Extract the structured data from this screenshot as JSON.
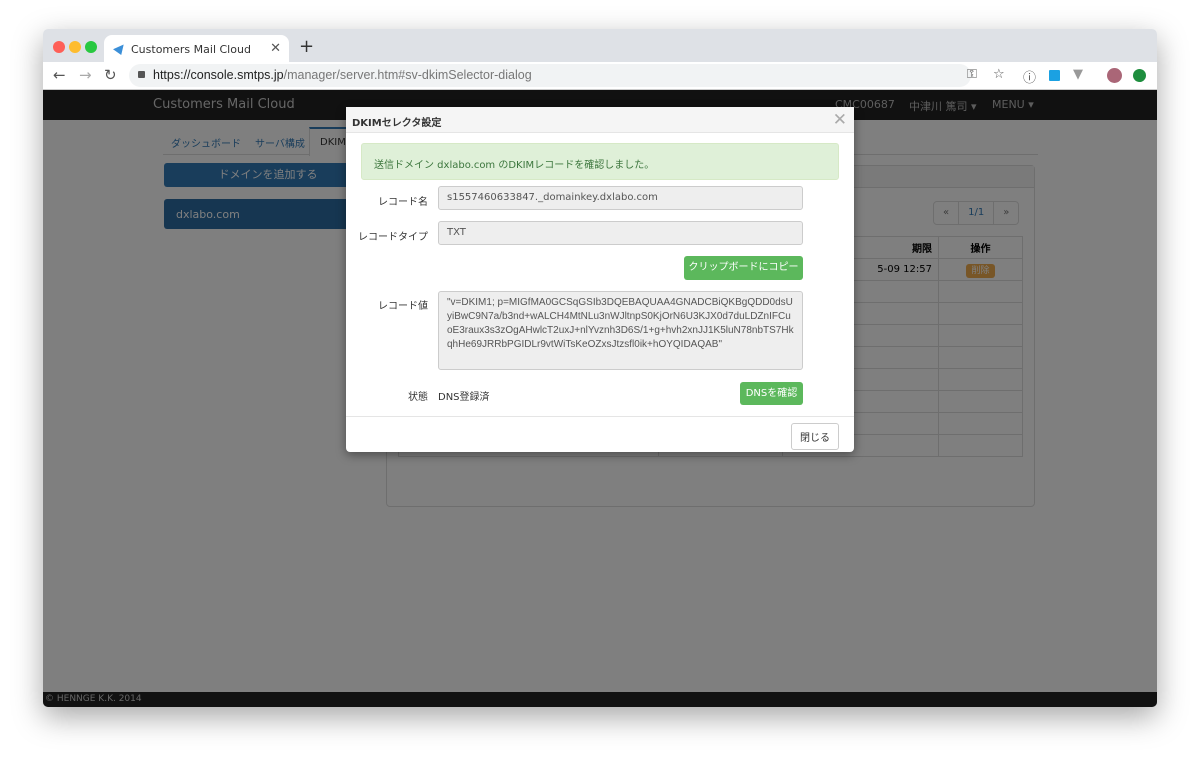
{
  "browser": {
    "tab_title": "Customers Mail Cloud",
    "url_host": "https://console.smtps.jp",
    "url_path": "/manager/server.htm#sv-dkimSelector-dialog"
  },
  "navbar": {
    "brand": "Customers Mail Cloud",
    "account": "CMC00687",
    "user": "中津川 篤司 ▾",
    "menu": "MENU ▾"
  },
  "page": {
    "tabs": [
      "ダッシュボード",
      "サーバ構成",
      "DKIM"
    ],
    "add_domain": "ドメインを追加する",
    "domain": "dxlabo.com",
    "pager": {
      "prev": "«",
      "current": "1/1",
      "next": "»"
    },
    "table": {
      "headers": [
        "",
        "",
        "期限",
        "操作"
      ],
      "first_row_date": "5-09 12:57",
      "delete_label": "削除"
    },
    "footer": "© HENNGE K.K. 2014"
  },
  "dialog": {
    "title": "DKIMセレクタ設定",
    "alert": "送信ドメイン dxlabo.com のDKIMレコードを確認しました。",
    "record_name_label": "レコード名",
    "record_name": "s1557460633847._domainkey.dxlabo.com",
    "record_type_label": "レコードタイプ",
    "record_type": "TXT",
    "copy_button": "クリップボードにコピー",
    "record_value_label": "レコード値",
    "record_value": "\"v=DKIM1; p=MIGfMA0GCSqGSIb3DQEBAQUAA4GNADCBiQKBgQDD0dsUyiBwC9N7a/b3nd+wALCH4MtNLu3nWJltnpS0KjOrN6U3KJX0d7duLDZnIFCuoE3raux3s3zOgAHwlcT2uxJ+nlYvznh3D6S/1+g+hvh2xnJJ1K5luN78nbTS7HkqhHe69JRRbPGIDLr9vtWiTsKeOZxsJtzsfl0ik+hOYQIDAQAB\"",
    "status_label": "状態",
    "status": "DNS登録済",
    "dns_button": "DNSを確認",
    "close_button": "閉じる"
  },
  "colors": {
    "primary": "#337ab7",
    "success": "#5cb85c",
    "alert_bg": "#dff0d8",
    "warning": "#f0ad4e"
  }
}
